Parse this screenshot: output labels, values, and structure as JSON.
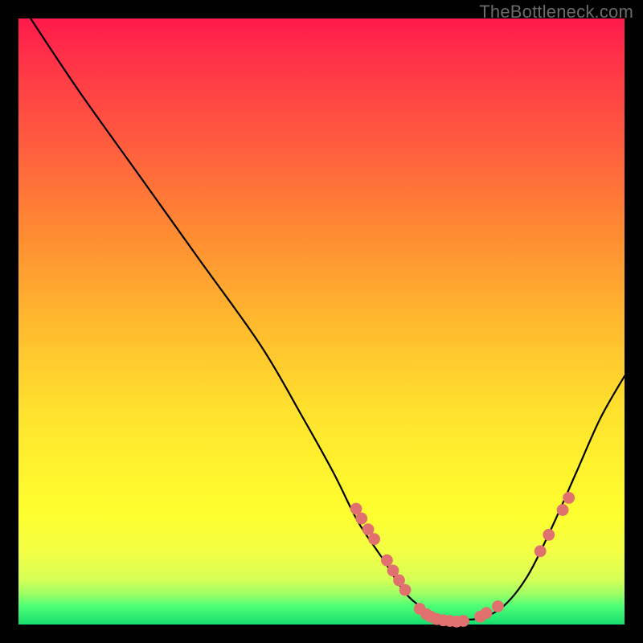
{
  "watermark": "TheBottleneck.com",
  "chart_data": {
    "type": "line",
    "title": "",
    "xlabel": "",
    "ylabel": "",
    "xlim": [
      0,
      100
    ],
    "ylim": [
      0,
      100
    ],
    "grid": false,
    "legend": false,
    "series": [
      {
        "name": "curve",
        "x": [
          2,
          10,
          20,
          30,
          40,
          47,
          52,
          56,
          60,
          64,
          68,
          72,
          76,
          80,
          84,
          88,
          92,
          96,
          100
        ],
        "y": [
          100,
          88,
          74,
          60,
          46,
          34,
          25,
          17,
          11,
          5,
          2,
          1,
          1,
          3,
          8,
          16,
          25,
          34,
          41
        ]
      }
    ],
    "markers": [
      {
        "xy": [
          55.7,
          19.1
        ]
      },
      {
        "xy": [
          56.6,
          17.5
        ]
      },
      {
        "xy": [
          57.7,
          15.7
        ]
      },
      {
        "xy": [
          58.7,
          14.1
        ]
      },
      {
        "xy": [
          60.8,
          10.6
        ]
      },
      {
        "xy": [
          61.8,
          8.9
        ]
      },
      {
        "xy": [
          62.8,
          7.3
        ]
      },
      {
        "xy": [
          63.8,
          5.7
        ]
      },
      {
        "xy": [
          66.2,
          2.6
        ]
      },
      {
        "xy": [
          67.3,
          1.7
        ]
      },
      {
        "xy": [
          68.0,
          1.3
        ]
      },
      {
        "xy": [
          69.0,
          0.9
        ]
      },
      {
        "xy": [
          70.1,
          0.7
        ]
      },
      {
        "xy": [
          71.2,
          0.6
        ]
      },
      {
        "xy": [
          72.3,
          0.5
        ]
      },
      {
        "xy": [
          73.4,
          0.6
        ]
      },
      {
        "xy": [
          76.2,
          1.3
        ]
      },
      {
        "xy": [
          77.2,
          1.9
        ]
      },
      {
        "xy": [
          79.1,
          3.0
        ]
      },
      {
        "xy": [
          86.1,
          12.1
        ]
      },
      {
        "xy": [
          87.5,
          14.8
        ]
      },
      {
        "xy": [
          89.8,
          18.9
        ]
      },
      {
        "xy": [
          90.8,
          20.9
        ]
      }
    ],
    "marker_color": "#e0716f",
    "curve_color": "#000000"
  }
}
